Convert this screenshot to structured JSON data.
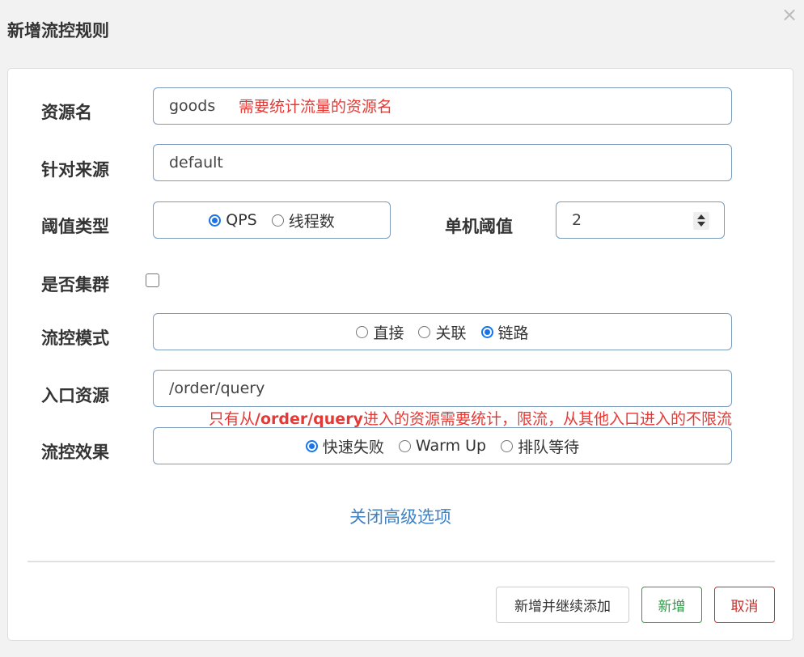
{
  "dialog": {
    "title": "新增流控规则",
    "close_glyph": "×"
  },
  "form": {
    "resource_name": {
      "label": "资源名",
      "value": "goods",
      "annotation": "需要统计流量的资源名"
    },
    "limit_app": {
      "label": "针对来源",
      "value": "default"
    },
    "threshold_type": {
      "label": "阈值类型",
      "options": [
        "QPS",
        "线程数"
      ],
      "selected": "QPS"
    },
    "single_threshold": {
      "label": "单机阈值",
      "value": "2"
    },
    "cluster_mode": {
      "label": "是否集群",
      "checked": false
    },
    "strategy": {
      "label": "流控模式",
      "options": [
        "直接",
        "关联",
        "链路"
      ],
      "selected": "链路"
    },
    "ref_resource": {
      "label": "入口资源",
      "value": "/order/query",
      "annotation_prefix": "只有从",
      "annotation_bold": "/order/query",
      "annotation_suffix": "进入的资源需要统计，限流，从其他入口进入的不限流"
    },
    "control_behavior": {
      "label": "流控效果",
      "options": [
        "快速失败",
        "Warm Up",
        "排队等待"
      ],
      "selected": "快速失败"
    },
    "advanced_toggle": "关闭高级选项"
  },
  "buttons": {
    "add_continue": "新增并继续添加",
    "add": "新增",
    "cancel": "取消"
  },
  "colors": {
    "annotation_red": "#e53935",
    "link_blue": "#3f82c4",
    "add_green": "#2e9b46",
    "cancel_red": "#c9302c",
    "radio_blue": "#1a73e8"
  }
}
